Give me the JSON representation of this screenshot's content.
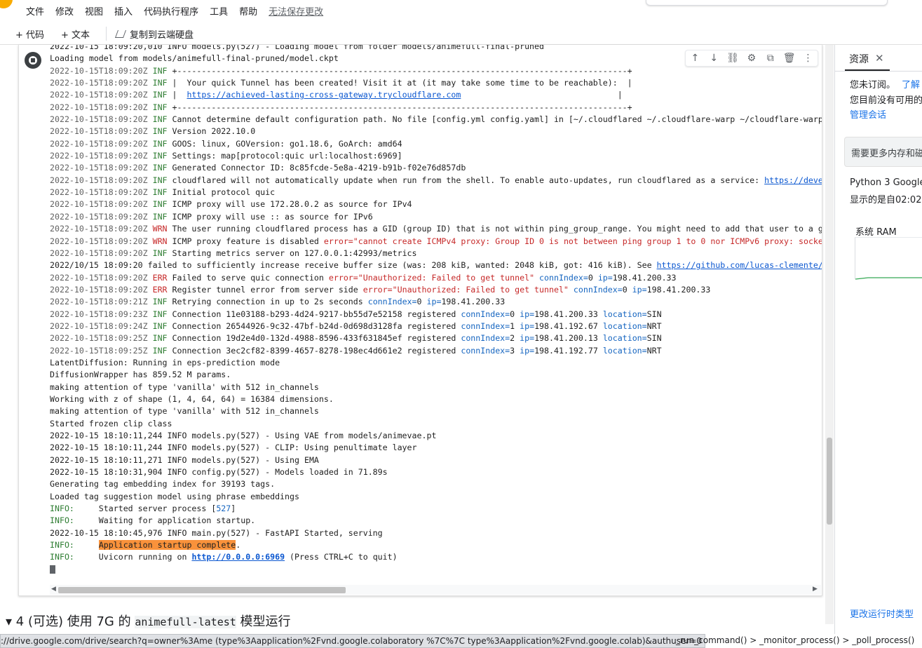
{
  "menu": {
    "items": [
      "文件",
      "修改",
      "视图",
      "插入",
      "代码执行程序",
      "工具",
      "帮助"
    ],
    "unsaved": "无法保存更改"
  },
  "toolbar": {
    "add_code": "+ 代码",
    "add_text": "+ 文本",
    "copy_to_drive": "复制到云端硬盘"
  },
  "cell_tools": [
    "move-up-icon",
    "move-down-icon",
    "link-icon",
    "gear-icon",
    "mirror-cell-icon",
    "delete-icon",
    "more-vert-icon"
  ],
  "output": {
    "lines": [
      [
        {
          "t": "2022-10-15 18:09:20,010 INFO models.py(527) - Loading model from folder models/animefull-final-pruned"
        }
      ],
      [
        {
          "t": "Loading model from models/animefull-final-pruned/model.ckpt"
        }
      ],
      [
        {
          "t": "2022-10-15T18:09:20Z",
          "c": "ts"
        },
        {
          "t": " INF",
          "c": "inf"
        },
        {
          "t": " +--------------------------------------------------------------------------------------------+"
        }
      ],
      [
        {
          "t": "2022-10-15T18:09:20Z",
          "c": "ts"
        },
        {
          "t": " INF",
          "c": "inf"
        },
        {
          "t": " |  Your quick Tunnel has been created! Visit it at (it may take some time to be reachable):  |"
        }
      ],
      [
        {
          "t": "2022-10-15T18:09:20Z",
          "c": "ts"
        },
        {
          "t": " INF",
          "c": "inf"
        },
        {
          "t": " |  "
        },
        {
          "t": "https://achieved-lasting-cross-gateway.trycloudflare.com",
          "c": "lnk"
        },
        {
          "t": "                                |"
        }
      ],
      [
        {
          "t": "2022-10-15T18:09:20Z",
          "c": "ts"
        },
        {
          "t": " INF",
          "c": "inf"
        },
        {
          "t": " +--------------------------------------------------------------------------------------------+"
        }
      ],
      [
        {
          "t": "2022-10-15T18:09:20Z",
          "c": "ts"
        },
        {
          "t": " INF",
          "c": "inf"
        },
        {
          "t": " Cannot determine default configuration path. No file [config.yml config.yaml] in [~/.cloudflared ~/.cloudflare-warp ~/cloudflare-warp"
        }
      ],
      [
        {
          "t": "2022-10-15T18:09:20Z",
          "c": "ts"
        },
        {
          "t": " INF",
          "c": "inf"
        },
        {
          "t": " Version 2022.10.0"
        }
      ],
      [
        {
          "t": "2022-10-15T18:09:20Z",
          "c": "ts"
        },
        {
          "t": " INF",
          "c": "inf"
        },
        {
          "t": " GOOS: linux, GOVersion: go1.18.6, GoArch: amd64"
        }
      ],
      [
        {
          "t": "2022-10-15T18:09:20Z",
          "c": "ts"
        },
        {
          "t": " INF",
          "c": "inf"
        },
        {
          "t": " Settings: map[protocol:quic url:localhost:6969]"
        }
      ],
      [
        {
          "t": "2022-10-15T18:09:20Z",
          "c": "ts"
        },
        {
          "t": " INF",
          "c": "inf"
        },
        {
          "t": " Generated Connector ID: 8c85fcde-5e8a-4219-b91b-f02e76d857db"
        }
      ],
      [
        {
          "t": "2022-10-15T18:09:20Z",
          "c": "ts"
        },
        {
          "t": " INF",
          "c": "inf"
        },
        {
          "t": " cloudflared will not automatically update when run from the shell. To enable auto-updates, run cloudflared as a service: "
        },
        {
          "t": "https://deve",
          "c": "lnk"
        }
      ],
      [
        {
          "t": "2022-10-15T18:09:20Z",
          "c": "ts"
        },
        {
          "t": " INF",
          "c": "inf"
        },
        {
          "t": " Initial protocol quic"
        }
      ],
      [
        {
          "t": "2022-10-15T18:09:20Z",
          "c": "ts"
        },
        {
          "t": " INF",
          "c": "inf"
        },
        {
          "t": " ICMP proxy will use 172.28.0.2 as source for IPv4"
        }
      ],
      [
        {
          "t": "2022-10-15T18:09:20Z",
          "c": "ts"
        },
        {
          "t": " INF",
          "c": "inf"
        },
        {
          "t": " ICMP proxy will use :: as source for IPv6"
        }
      ],
      [
        {
          "t": "2022-10-15T18:09:20Z",
          "c": "ts"
        },
        {
          "t": " WRN",
          "c": "wrn"
        },
        {
          "t": " The user running cloudflared process has a GID (group ID) that is not within ping_group_range. You might need to add that user to a g"
        }
      ],
      [
        {
          "t": "2022-10-15T18:09:20Z",
          "c": "ts"
        },
        {
          "t": " WRN",
          "c": "wrn"
        },
        {
          "t": " ICMP proxy feature is disabled "
        },
        {
          "t": "error=",
          "c": "errv"
        },
        {
          "t": "\"cannot create ICMPv4 proxy: Group ID 0 is not between ping group 1 to 0 nor ICMPv6 proxy: socke",
          "c": "errv"
        }
      ],
      [
        {
          "t": "2022-10-15T18:09:20Z",
          "c": "ts"
        },
        {
          "t": " INF",
          "c": "inf"
        },
        {
          "t": " Starting metrics server on 127.0.0.1:42993/metrics"
        }
      ],
      [
        {
          "t": "2022/10/15 18:09:20 failed to sufficiently increase receive buffer size (was: 208 kiB, wanted: 2048 kiB, got: 416 kiB). See "
        },
        {
          "t": "https://github.com/lucas-clemente/",
          "c": "lnk"
        }
      ],
      [
        {
          "t": "2022-10-15T18:09:20Z",
          "c": "ts"
        },
        {
          "t": " ERR",
          "c": "err"
        },
        {
          "t": " Failed to serve quic connection "
        },
        {
          "t": "error=",
          "c": "errv"
        },
        {
          "t": "\"Unauthorized: Failed to get tunnel\"",
          "c": "errv"
        },
        {
          "t": " "
        },
        {
          "t": "connIndex=",
          "c": "kv"
        },
        {
          "t": "0 "
        },
        {
          "t": "ip=",
          "c": "kv"
        },
        {
          "t": "198.41.200.33"
        }
      ],
      [
        {
          "t": "2022-10-15T18:09:20Z",
          "c": "ts"
        },
        {
          "t": " ERR",
          "c": "err"
        },
        {
          "t": " Register tunnel error from server side "
        },
        {
          "t": "error=",
          "c": "errv"
        },
        {
          "t": "\"Unauthorized: Failed to get tunnel\"",
          "c": "errv"
        },
        {
          "t": " "
        },
        {
          "t": "connIndex=",
          "c": "kv"
        },
        {
          "t": "0 "
        },
        {
          "t": "ip=",
          "c": "kv"
        },
        {
          "t": "198.41.200.33"
        }
      ],
      [
        {
          "t": "2022-10-15T18:09:21Z",
          "c": "ts"
        },
        {
          "t": " INF",
          "c": "inf"
        },
        {
          "t": " Retrying connection in up to 2s seconds "
        },
        {
          "t": "connIndex=",
          "c": "kv"
        },
        {
          "t": "0 "
        },
        {
          "t": "ip=",
          "c": "kv"
        },
        {
          "t": "198.41.200.33"
        }
      ],
      [
        {
          "t": "2022-10-15T18:09:23Z",
          "c": "ts"
        },
        {
          "t": " INF",
          "c": "inf"
        },
        {
          "t": " Connection 11e03188-b293-4d24-9217-bb55d7e52158 registered "
        },
        {
          "t": "connIndex=",
          "c": "kv"
        },
        {
          "t": "0 "
        },
        {
          "t": "ip=",
          "c": "kv"
        },
        {
          "t": "198.41.200.33 "
        },
        {
          "t": "location=",
          "c": "kv"
        },
        {
          "t": "SIN"
        }
      ],
      [
        {
          "t": "2022-10-15T18:09:24Z",
          "c": "ts"
        },
        {
          "t": " INF",
          "c": "inf"
        },
        {
          "t": " Connection 26544926-9c32-47bf-b24d-0d698d3128fa registered "
        },
        {
          "t": "connIndex=",
          "c": "kv"
        },
        {
          "t": "1 "
        },
        {
          "t": "ip=",
          "c": "kv"
        },
        {
          "t": "198.41.192.67 "
        },
        {
          "t": "location=",
          "c": "kv"
        },
        {
          "t": "NRT"
        }
      ],
      [
        {
          "t": "2022-10-15T18:09:25Z",
          "c": "ts"
        },
        {
          "t": " INF",
          "c": "inf"
        },
        {
          "t": " Connection 19d2e4d0-132d-4988-8596-433f631845ef registered "
        },
        {
          "t": "connIndex=",
          "c": "kv"
        },
        {
          "t": "2 "
        },
        {
          "t": "ip=",
          "c": "kv"
        },
        {
          "t": "198.41.200.13 "
        },
        {
          "t": "location=",
          "c": "kv"
        },
        {
          "t": "SIN"
        }
      ],
      [
        {
          "t": "2022-10-15T18:09:25Z",
          "c": "ts"
        },
        {
          "t": " INF",
          "c": "inf"
        },
        {
          "t": " Connection 3ec2cf82-8399-4657-8278-198ec4d661e2 registered "
        },
        {
          "t": "connIndex=",
          "c": "kv"
        },
        {
          "t": "3 "
        },
        {
          "t": "ip=",
          "c": "kv"
        },
        {
          "t": "198.41.192.77 "
        },
        {
          "t": "location=",
          "c": "kv"
        },
        {
          "t": "NRT"
        }
      ],
      [
        {
          "t": "LatentDiffusion: Running in eps-prediction mode"
        }
      ],
      [
        {
          "t": "DiffusionWrapper has 859.52 M params."
        }
      ],
      [
        {
          "t": "making attention of type 'vanilla' with 512 in_channels"
        }
      ],
      [
        {
          "t": "Working with z of shape (1, 4, 64, 64) = 16384 dimensions."
        }
      ],
      [
        {
          "t": "making attention of type 'vanilla' with 512 in_channels"
        }
      ],
      [
        {
          "t": "Started frozen clip class"
        }
      ],
      [
        {
          "t": "2022-10-15 18:10:11,244 INFO models.py(527) - Using VAE from models/animevae.pt"
        }
      ],
      [
        {
          "t": "2022-10-15 18:10:11,244 INFO models.py(527) - CLIP: Using penultimate layer"
        }
      ],
      [
        {
          "t": "2022-10-15 18:10:11,271 INFO models.py(527) - Using EMA"
        }
      ],
      [
        {
          "t": "2022-10-15 18:10:31,904 INFO config.py(527) - Models loaded in 71.89s"
        }
      ],
      [
        {
          "t": "Generating tag embedding index for 39193 tags."
        }
      ],
      [
        {
          "t": "Loaded tag suggestion model using phrase embeddings"
        }
      ],
      [
        {
          "t": "INFO:",
          "c": "info-tag"
        },
        {
          "t": "     Started server process ["
        },
        {
          "t": "527",
          "c": "kv"
        },
        {
          "t": "]"
        }
      ],
      [
        {
          "t": "INFO:",
          "c": "info-tag"
        },
        {
          "t": "     Waiting for application startup."
        }
      ],
      [
        {
          "t": "2022-10-15 18:10:45,976 INFO main.py(527) - FastAPI Started, serving"
        }
      ],
      [
        {
          "t": "INFO:",
          "c": "info-tag"
        },
        {
          "t": "     "
        },
        {
          "t": "Application startup complete",
          "c": "hl"
        },
        {
          "t": "."
        }
      ],
      [
        {
          "t": "INFO:",
          "c": "info-tag"
        },
        {
          "t": "     Uvicorn running on "
        },
        {
          "t": "http://0.0.0.0:6969",
          "c": "lnk-bold"
        },
        {
          "t": " (Press CTRL+C to quit)"
        }
      ]
    ]
  },
  "next_section": {
    "number": "4",
    "text_before": "(可选) 使用 7G 的 ",
    "code": "animefull-latest",
    "text_after": " 模型运行"
  },
  "panel": {
    "tab": "资源",
    "not_subscribed": "您未订阅。",
    "learn_more": "了解",
    "no_available": "您目前没有可用的",
    "manage_sessions": "管理会话",
    "need_more": "需要更多内存和磁",
    "python_line": "Python 3 Google",
    "shown_line": "显示的是自02:02",
    "ram_label": "系统 RAM",
    "ram_usage_fraction": 0.05,
    "change_runtime": "更改运行时类型"
  },
  "status": {
    "url": "://drive.google.com/drive/search?q=owner%3Ame (type%3Aapplication%2Fvnd.google.colaboratory %7C%7C type%3Aapplication%2Fvnd.google.colab)&authuser=0",
    "trace": "_run_command() > _monitor_process() > _poll_process()"
  }
}
